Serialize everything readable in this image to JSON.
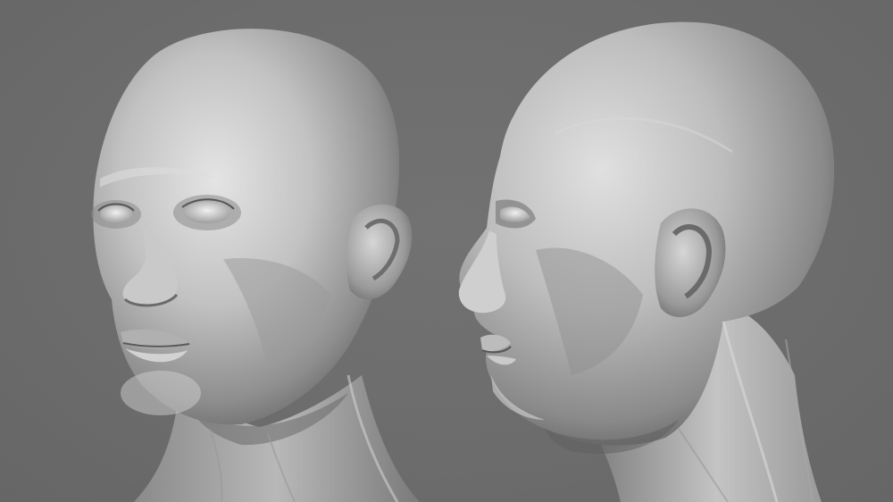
{
  "scene": {
    "background_color": "#6d6d6d",
    "material_color": "#bdbdbd",
    "material_shadow_color": "#4a4a4a",
    "subjects": [
      {
        "view": "three-quarter-front"
      },
      {
        "view": "side-profile"
      }
    ]
  }
}
